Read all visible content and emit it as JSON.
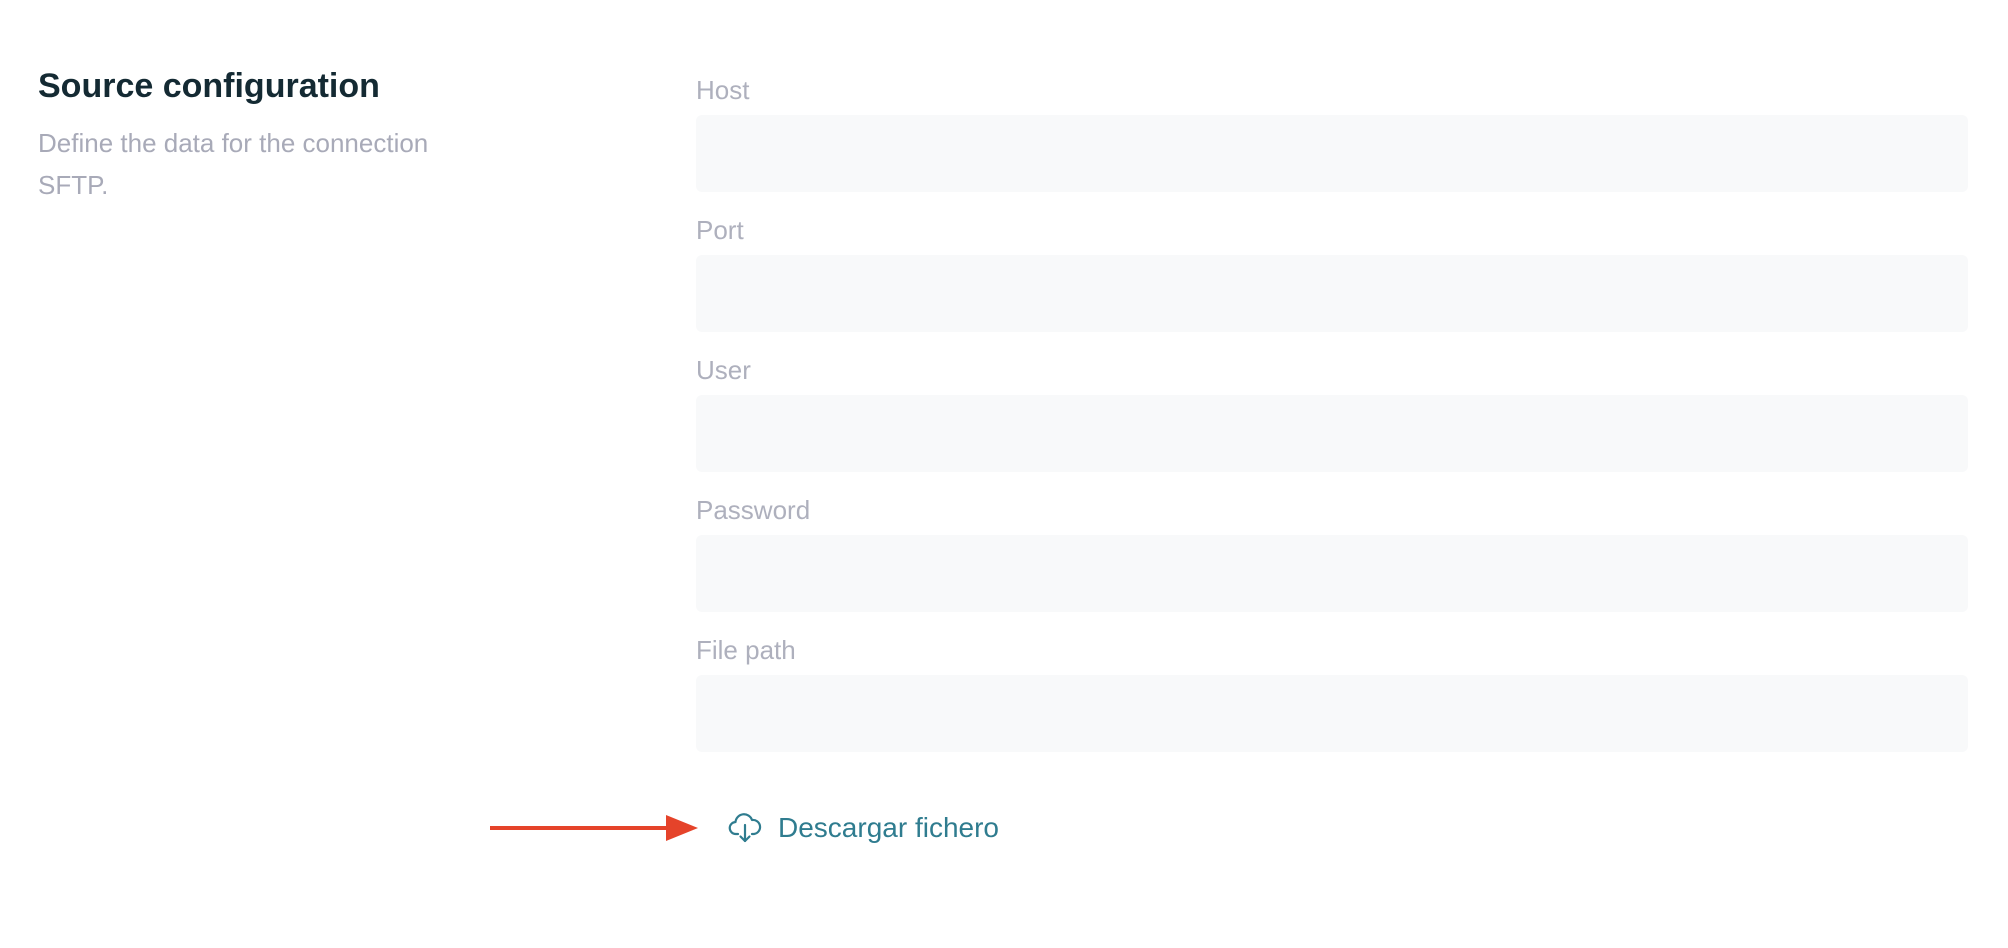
{
  "section": {
    "title": "Source configuration",
    "description_line1": "Define the data for the connection",
    "description_line2": "SFTP."
  },
  "form": {
    "fields": [
      {
        "label": "Host",
        "value": ""
      },
      {
        "label": "Port",
        "value": ""
      },
      {
        "label": "User",
        "value": ""
      },
      {
        "label": "Password",
        "value": ""
      },
      {
        "label": "File path",
        "value": ""
      }
    ]
  },
  "download": {
    "label": "Descargar fichero",
    "icon": "cloud-download-icon"
  },
  "colors": {
    "title": "#142a33",
    "muted_text": "#a8aab8",
    "input_background": "#f8f9fa",
    "link": "#2f7c8f",
    "annotation_arrow": "#e5432a"
  }
}
